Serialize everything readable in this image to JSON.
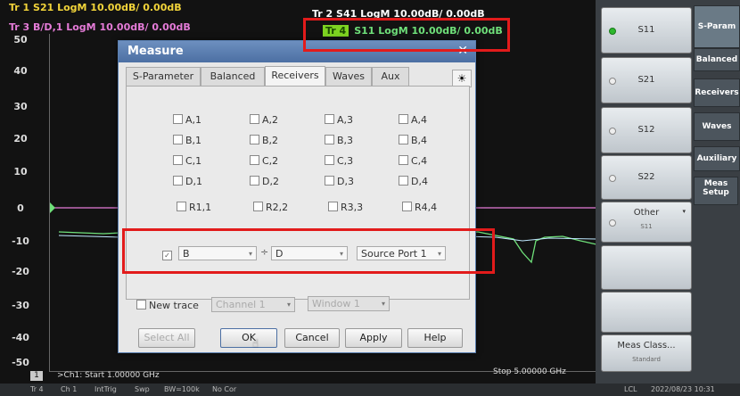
{
  "traces": {
    "tr1": "Tr 1  S21 LogM 10.00dB/ 0.00dB",
    "tr3": "Tr 3  B/D,1 LogM 10.00dB/ 0.00dB",
    "tr2": "Tr 2  S41 LogM 10.00dB/ 0.00dB",
    "tr4_badge": "Tr 4",
    "tr4_text": "S11 LogM 10.00dB/ 0.00dB",
    "colors": {
      "tr1": "#f2d43a",
      "tr3": "#e57bd8",
      "tr2": "#ffffff",
      "tr4": "#6fe07a"
    }
  },
  "y_axis": [
    "50",
    "40",
    "30",
    "20",
    "10",
    "0",
    "-10",
    "-20",
    "-30",
    "-40",
    "-50"
  ],
  "channel_footer": {
    "channel_number": "1",
    "start": ">Ch1: Start  1.00000 GHz",
    "stop": "Stop  5.00000 GHz"
  },
  "dialog": {
    "title": "Measure",
    "tabs": [
      "S-Parameter",
      "Balanced",
      "Receivers",
      "Waves",
      "Aux"
    ],
    "selected_tab": "Receivers",
    "receivers": {
      "row_a": [
        "A,1",
        "A,2",
        "A,3",
        "A,4"
      ],
      "row_b": [
        "B,1",
        "B,2",
        "B,3",
        "B,4"
      ],
      "row_c": [
        "C,1",
        "C,2",
        "C,3",
        "C,4"
      ],
      "row_d": [
        "D,1",
        "D,2",
        "D,3",
        "D,4"
      ],
      "row_r": [
        "R1,1",
        "R2,2",
        "R3,3",
        "R4,4"
      ]
    },
    "ratio": {
      "numerator": "B",
      "operator": "÷",
      "denominator": "D",
      "source_port": "Source Port 1"
    },
    "new_trace_label": "New trace",
    "channel_select": "Channel 1",
    "window_select": "Window 1",
    "buttons": {
      "select_all": "Select All",
      "ok": "OK",
      "cancel": "Cancel",
      "apply": "Apply",
      "help": "Help"
    }
  },
  "softkeys": {
    "s11": "S11",
    "s21": "S21",
    "s12": "S12",
    "s22": "S22",
    "other": "Other",
    "other_sub": "S11",
    "meas_class": "Meas Class...",
    "meas_class_sub": "Standard"
  },
  "right_tabs": [
    "S-Param",
    "Balanced",
    "Receivers",
    "Waves",
    "Auxiliary",
    "Meas Setup"
  ],
  "status_bar": {
    "trace": "Tr 4",
    "channel": "Ch 1",
    "trigger": "IntTrig",
    "sweep": "Swp",
    "bw": "BW=100k",
    "cor": "No Cor",
    "lcl": "LCL",
    "datetime": "2022/08/23 10:31"
  }
}
